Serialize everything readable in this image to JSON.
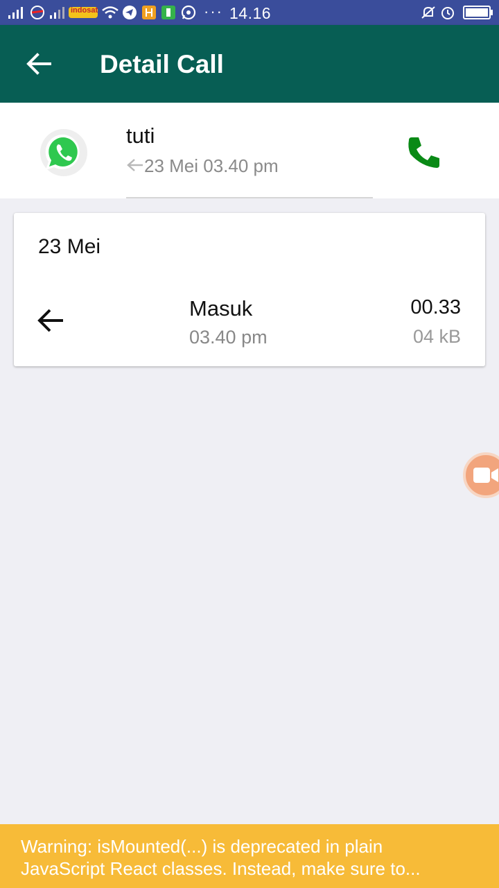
{
  "status_bar": {
    "time": "14.16",
    "carrier_badge": "indosat",
    "icons": [
      "signal-icon",
      "carrier-logo-icon",
      "signal-icon",
      "indosat-icon",
      "wifi-icon",
      "telegram-icon",
      "app-icon",
      "battery-saver-icon",
      "whatsapp-icon",
      "more-icon",
      "mute-icon",
      "alarm-icon",
      "battery-icon"
    ]
  },
  "app_bar": {
    "title": "Detail Call",
    "back_icon": "arrow-left-icon",
    "color": "#075e54"
  },
  "contact": {
    "name": "tuti",
    "last_call": "23 Mei 03.40 pm",
    "direction_icon": "incoming-arrow-icon",
    "avatar_icon": "whatsapp-icon",
    "call_icon": "phone-icon",
    "call_icon_color": "#0a8a16"
  },
  "call_log": {
    "date": "23 Mei",
    "entries": [
      {
        "direction_icon": "arrow-left-icon",
        "type": "Masuk",
        "time": "03.40 pm",
        "duration": "00.33",
        "data_size": "04 kB"
      }
    ]
  },
  "floating_button": {
    "icon": "video-camera-icon",
    "color": "#f2a57d"
  },
  "warning": {
    "line1": "Warning: isMounted(...) is deprecated in plain",
    "line2": "JavaScript React classes. Instead, make sure to...",
    "color": "#f7bb38"
  }
}
